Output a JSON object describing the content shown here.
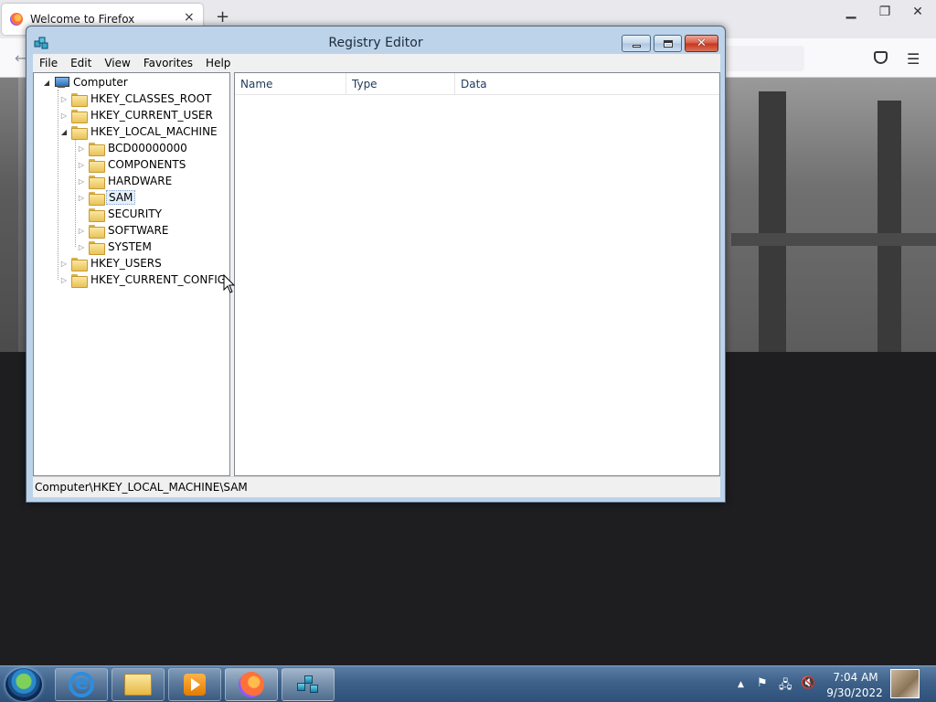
{
  "firefox": {
    "tab_title": "Welcome to Firefox",
    "tab_close": "×",
    "new_tab": "+",
    "back": "←",
    "menu": "☰",
    "min": "▁",
    "restore": "❐",
    "close": "✕"
  },
  "regedit": {
    "title": "Registry Editor",
    "caption_close": "✕",
    "menu": [
      "File",
      "Edit",
      "View",
      "Favorites",
      "Help"
    ],
    "tree": {
      "root": "Computer",
      "hives": [
        "HKEY_CLASSES_ROOT",
        "HKEY_CURRENT_USER",
        "HKEY_LOCAL_MACHINE",
        "HKEY_USERS",
        "HKEY_CURRENT_CONFIG"
      ],
      "hklm_children": [
        "BCD00000000",
        "COMPONENTS",
        "HARDWARE",
        "SAM",
        "SECURITY",
        "SOFTWARE",
        "SYSTEM"
      ],
      "selected": "SAM",
      "expander_collapsed": "▷",
      "expander_expanded": "◢"
    },
    "columns": [
      "Name",
      "Type",
      "Data"
    ],
    "status_path": "Computer\\HKEY_LOCAL_MACHINE\\SAM"
  },
  "taskbar": {
    "tray_up": "▲",
    "tray_flag": "⚑",
    "tray_network": "🖧",
    "tray_volume": "🔇",
    "time": "7:04 AM",
    "date": "9/30/2022"
  }
}
